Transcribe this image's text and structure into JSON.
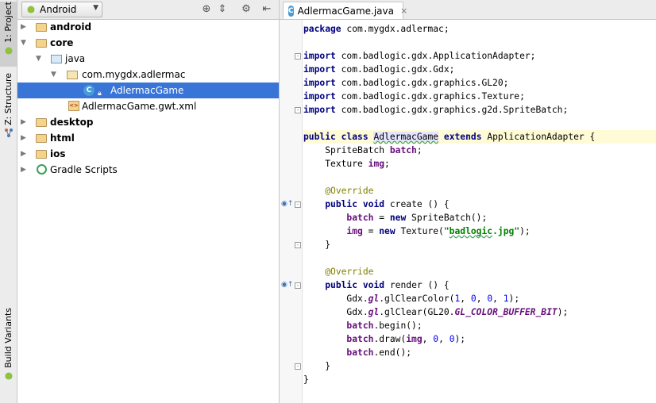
{
  "sidebar_tabs": {
    "project": "1: Project",
    "structure": "Z: Structure",
    "build_variants": "Build Variants"
  },
  "project_panel": {
    "view_selector": "Android",
    "tree": [
      {
        "label": "android",
        "bold": true,
        "expanded": false,
        "icon": "module-folder-icon"
      },
      {
        "label": "core",
        "bold": true,
        "expanded": true,
        "icon": "module-folder-icon"
      },
      {
        "label": "java",
        "bold": false,
        "expanded": true,
        "icon": "source-folder-icon"
      },
      {
        "label": "com.mygdx.adlermac",
        "bold": false,
        "expanded": true,
        "icon": "package-icon"
      },
      {
        "label": "AdlermacGame",
        "bold": false,
        "selected": true,
        "icon": "class-icon"
      },
      {
        "label": "AdlermacGame.gwt.xml",
        "bold": false,
        "icon": "xml-file-icon"
      },
      {
        "label": "desktop",
        "bold": true,
        "expanded": false,
        "icon": "module-folder-icon"
      },
      {
        "label": "html",
        "bold": true,
        "expanded": false,
        "icon": "module-folder-icon"
      },
      {
        "label": "ios",
        "bold": true,
        "expanded": false,
        "icon": "module-folder-icon"
      },
      {
        "label": "Gradle Scripts",
        "bold": false,
        "expanded": false,
        "icon": "gradle-icon"
      }
    ]
  },
  "editor": {
    "tab_label": "AdlermacGame.java",
    "tab_close": "×",
    "code": {
      "l1_kw": "package",
      "l1_rest": " com.mygdx.adlermac;",
      "imports": [
        "com.badlogic.gdx.ApplicationAdapter;",
        "com.badlogic.gdx.Gdx;",
        "com.badlogic.gdx.graphics.GL20;",
        "com.badlogic.gdx.graphics.Texture;",
        "com.badlogic.gdx.graphics.g2d.SpriteBatch;"
      ],
      "import_kw": "import",
      "public_kw": "public",
      "class_kw": "class",
      "class_name": "AdlermacGame",
      "extends_kw": "extends",
      "superclass": "ApplicationAdapter {",
      "field1_type": "SpriteBatch ",
      "field1_name": "batch",
      "field2_type": "Texture ",
      "field2_name": "img",
      "override": "@Override",
      "void_kw": "void",
      "create_sig": " create () {",
      "render_sig": " render () {",
      "new_kw": "new",
      "sprite_ctor": " SpriteBatch();",
      "texture_ctor": " Texture(",
      "texture_file": "badlogic",
      "texture_ext": ".jpg",
      "gdx": "Gdx.",
      "gl": "gl",
      "clear_color_call": ".glClearColor(",
      "num_1": "1",
      "num_0": "0",
      "clear_call": ".glClear(GL20.",
      "gl_const": "GL_COLOR_BUFFER_BIT",
      "begin_call": ".begin();",
      "draw_call": ".draw(",
      "end_call": ".end();",
      "close_brace": "}"
    }
  }
}
